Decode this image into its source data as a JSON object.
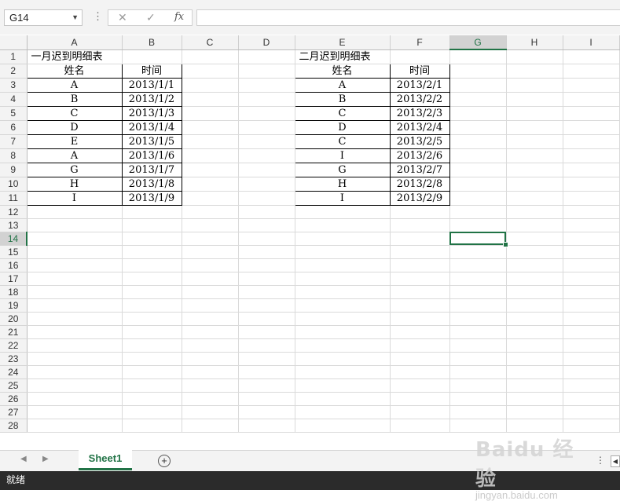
{
  "name_box": "G14",
  "formula_bar": {
    "cancel_icon": "✕",
    "enter_icon": "✓",
    "function_icon": "fx",
    "value": ""
  },
  "columns": [
    "A",
    "B",
    "C",
    "D",
    "E",
    "F",
    "G",
    "H",
    "I"
  ],
  "rows": [
    "1",
    "2",
    "3",
    "4",
    "5",
    "6",
    "7",
    "8",
    "9",
    "10",
    "11",
    "12",
    "13",
    "14",
    "15",
    "16",
    "17",
    "18",
    "19",
    "20",
    "21",
    "22",
    "23",
    "24",
    "25",
    "26",
    "27",
    "28"
  ],
  "table1": {
    "title": "一月迟到明细表",
    "headers": [
      "姓名",
      "时间"
    ],
    "rows": [
      [
        "A",
        "2013/1/1"
      ],
      [
        "B",
        "2013/1/2"
      ],
      [
        "C",
        "2013/1/3"
      ],
      [
        "D",
        "2013/1/4"
      ],
      [
        "E",
        "2013/1/5"
      ],
      [
        "A",
        "2013/1/6"
      ],
      [
        "G",
        "2013/1/7"
      ],
      [
        "H",
        "2013/1/8"
      ],
      [
        "I",
        "2013/1/9"
      ]
    ]
  },
  "table2": {
    "title": "二月迟到明细表",
    "headers": [
      "姓名",
      "时间"
    ],
    "rows": [
      [
        "A",
        "2013/2/1"
      ],
      [
        "B",
        "2013/2/2"
      ],
      [
        "C",
        "2013/2/3"
      ],
      [
        "D",
        "2013/2/4"
      ],
      [
        "C",
        "2013/2/5"
      ],
      [
        "I",
        "2013/2/6"
      ],
      [
        "G",
        "2013/2/7"
      ],
      [
        "H",
        "2013/2/8"
      ],
      [
        "I",
        "2013/2/9"
      ]
    ]
  },
  "sheet_tabs": [
    "Sheet1"
  ],
  "status": "就绪",
  "watermark": {
    "logo": "Baidu 经验",
    "url": "jingyan.baidu.com"
  },
  "colors": {
    "accent": "#217346",
    "header_bg": "#f3f3f3",
    "status_bg": "#2b2b2b"
  }
}
